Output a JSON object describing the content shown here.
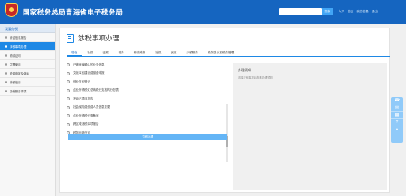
{
  "header": {
    "title": "国家税务总局青海省电子税务局",
    "search_placeholder": "",
    "search_button": "搜索",
    "links": [
      "大字",
      "首页",
      "我的信息",
      "退出"
    ],
    "emblem_icon": "tax-emblem"
  },
  "sidebar": {
    "heading": "我要办税",
    "items": [
      {
        "label": "综合信息报告",
        "active": false
      },
      {
        "label": "涉税事项办理",
        "active": true
      },
      {
        "label": "税收证明",
        "active": false
      },
      {
        "label": "发票使用",
        "active": false
      },
      {
        "label": "税费申报及缴纳",
        "active": false
      },
      {
        "label": "纳税信用",
        "active": false
      },
      {
        "label": "其他服务事项",
        "active": false
      }
    ]
  },
  "panel": {
    "title": "涉税事项办理",
    "tabs": [
      "增值",
      "社保",
      "证照",
      "税务",
      "税收减免",
      "社保",
      "优惠",
      "涉税服务",
      "税务总计及税务管理"
    ],
    "active_tab": 0,
    "list": [
      "已被备案确认的业务信息",
      "文化事业建设费缴费申报",
      "停业复业登记",
      "企业所得税汇总纳税分支机构分配表",
      "不动产项目报告",
      "社会保险费缴费人员信息变更",
      "企业所得税优惠备案",
      "跨区域涉税事项报告",
      "税务行政许可"
    ],
    "confirm_button": "立即办理"
  },
  "info": {
    "title": "办理须知",
    "text": "选择左侧事项后查看办理须知"
  },
  "float_bar": {
    "icons": [
      "phone-icon",
      "chat-icon",
      "qr-code-icon",
      "help-icon",
      "top-arrow-icon"
    ],
    "glyphs": [
      "☎",
      "✉",
      "▦",
      "?",
      "▲"
    ]
  },
  "colors": {
    "brand": "#1565c0",
    "accent": "#1e88e5"
  }
}
